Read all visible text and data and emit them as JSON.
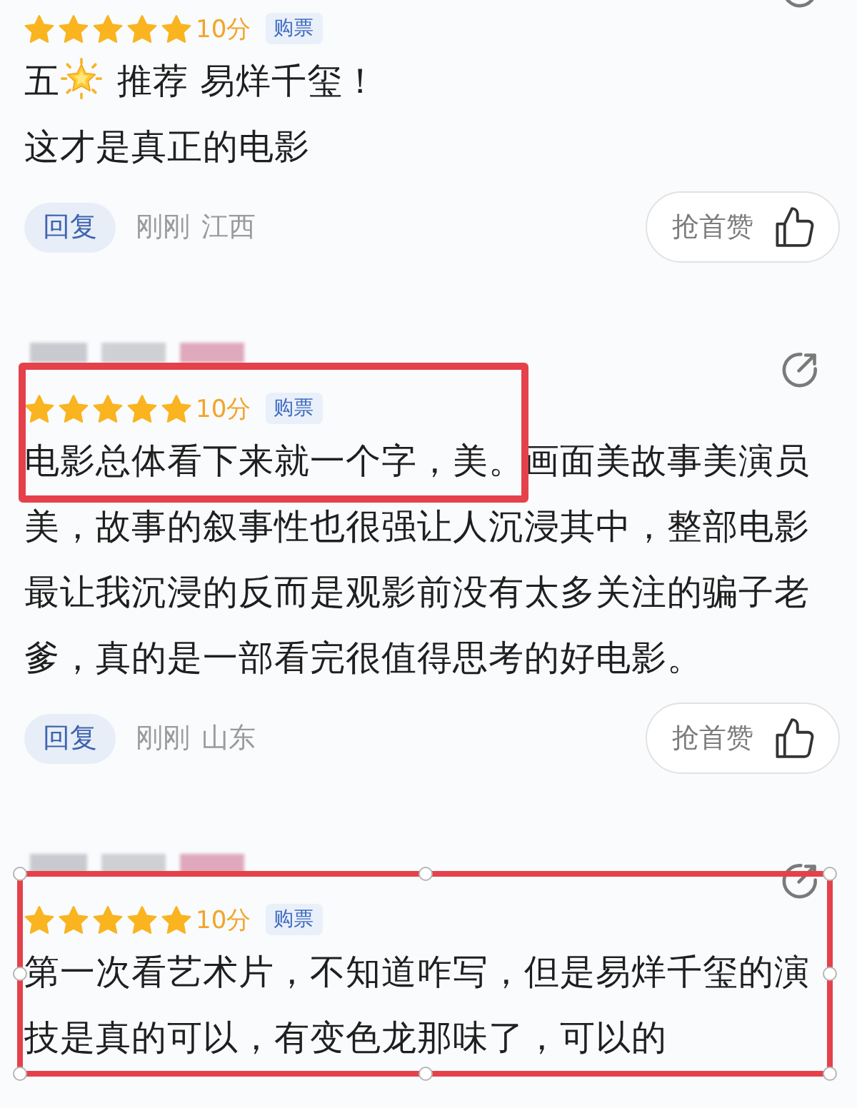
{
  "reviews": [
    {
      "stars": 5,
      "score": "10分",
      "badge": "购票",
      "paragraphs": [
        [
          {
            "kind": "text",
            "text": "五"
          },
          {
            "kind": "star-emoji"
          },
          {
            "kind": "text",
            "text": "推荐 易烊千玺！"
          }
        ],
        [
          {
            "kind": "text",
            "text": "这才是真正的电影"
          }
        ]
      ],
      "reply_button": "回复",
      "time": "刚刚",
      "location": "江西",
      "like_button": "抢首赞"
    },
    {
      "username_blurred": true,
      "annotation": {
        "kind": "frame"
      },
      "stars": 5,
      "score": "10分",
      "badge": "购票",
      "paragraphs": [
        [
          {
            "kind": "text",
            "text": "电影总体看下来就一个字，美。画面美故事美演员美，故事的叙事性也很强让人沉浸其中，整部电影最让我沉浸的反而是观影前没有太多关注的骗子老爹，真的是一部看完很值得思考的好电影。"
          }
        ]
      ],
      "reply_button": "回复",
      "time": "刚刚",
      "location": "山东",
      "like_button": "抢首赞"
    },
    {
      "username_blurred": true,
      "annotation": {
        "kind": "selection"
      },
      "stars": 5,
      "score": "10分",
      "badge": "购票",
      "paragraphs": [
        [
          {
            "kind": "text",
            "text": "第一次看艺术片，不知道咋写，但是易烊千玺的演技是真的可以，有变色龙那味了，可以的"
          }
        ]
      ]
    }
  ]
}
